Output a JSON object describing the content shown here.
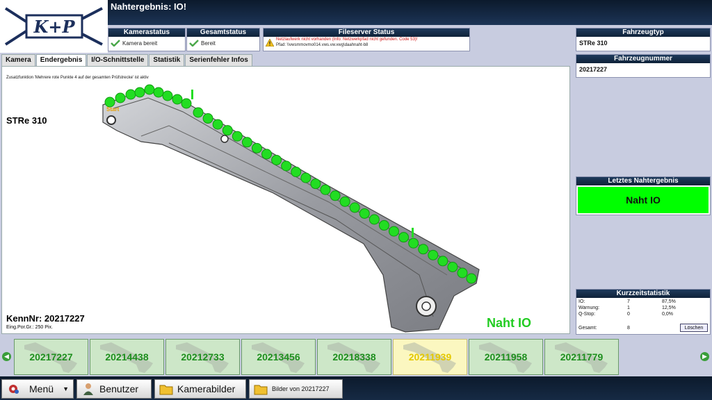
{
  "logo_text": "K+P",
  "title": "Nahtergebnis: IO!",
  "status": {
    "kamera": {
      "title": "Kamerastatus",
      "text": "Kamera bereit"
    },
    "gesamt": {
      "title": "Gesamtstatus",
      "text": "Bereit"
    },
    "fileserver": {
      "title": "Fileserver Status",
      "line1": "Netzlaufwerk nicht vorhanden (Info:  Netzwerkpfad nicht gefunden. Code 53)!",
      "line2": "Pfad: \\\\vwsmmovmo014.vws.vw.vwg\\daahnaht-b8"
    }
  },
  "tabs": [
    "Kamera",
    "Endergebnis",
    "I/O-Schnittstelle",
    "Statistik",
    "Serienfehler Infos"
  ],
  "main": {
    "note": "Zusatzfunktion 'Mehrere rote Punkte 4 auf der gesamten Prüfstrecke' ist aktiv",
    "model": "STRe 310",
    "start_label": "Start",
    "kennnr": "KennNr:  20217227",
    "eing": "Eing.Por.Gr.: 250 Pix.",
    "result": "Naht IO"
  },
  "right": {
    "fahrzeugtyp": {
      "title": "Fahrzeugtyp",
      "value": "STRe 310"
    },
    "fahrzeugnummer": {
      "title": "Fahrzeugnummer",
      "value": "20217227"
    },
    "letztes": {
      "title": "Letztes Nahtergebnis",
      "value": "Naht IO"
    },
    "kurz": {
      "title": "Kurzzeitstatistik",
      "rows": [
        {
          "label": "IO:",
          "count": "7",
          "pct": "87,5%"
        },
        {
          "label": "Warnung:",
          "count": "1",
          "pct": "12,5%"
        },
        {
          "label": "Q-Stop:",
          "count": "0",
          "pct": "0,0%"
        }
      ],
      "gesamt_label": "Gesamt:",
      "gesamt_value": "8",
      "clear_label": "Löschen"
    }
  },
  "thumbnails": [
    {
      "label": "20217227",
      "state": "ok"
    },
    {
      "label": "20214438",
      "state": "ok"
    },
    {
      "label": "20212733",
      "state": "ok"
    },
    {
      "label": "20213456",
      "state": "ok"
    },
    {
      "label": "20218338",
      "state": "ok"
    },
    {
      "label": "20211939",
      "state": "warn"
    },
    {
      "label": "20211958",
      "state": "ok"
    },
    {
      "label": "20211779",
      "state": "ok"
    }
  ],
  "footer": {
    "menu": "Menü",
    "benutzer": "Benutzer",
    "kamerabilder": "Kamerabilder",
    "bilder": "Bilder von 20217227"
  },
  "colors": {
    "ok_green": "#00ff00",
    "dot_green": "#22dd22",
    "dark_header": "#0f2238",
    "bg": "#c8cce0"
  }
}
